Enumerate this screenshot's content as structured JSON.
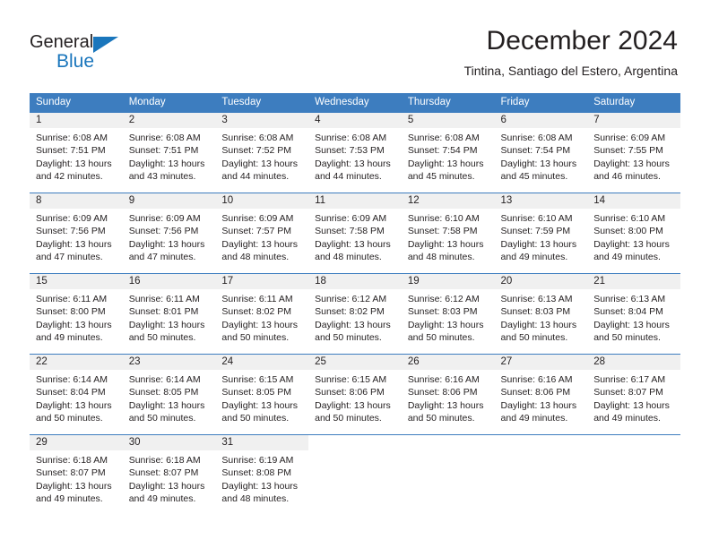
{
  "brand": {
    "name_part1": "General",
    "name_part2": "Blue",
    "accent_color": "#1a76bc"
  },
  "header": {
    "title": "December 2024",
    "location": "Tintina, Santiago del Estero, Argentina"
  },
  "calendar": {
    "header_color": "#3d7dbf",
    "weekdays": [
      "Sunday",
      "Monday",
      "Tuesday",
      "Wednesday",
      "Thursday",
      "Friday",
      "Saturday"
    ],
    "weeks": [
      [
        {
          "day": "1",
          "sunrise": "Sunrise: 6:08 AM",
          "sunset": "Sunset: 7:51 PM",
          "daylight_line1": "Daylight: 13 hours",
          "daylight_line2": "and 42 minutes."
        },
        {
          "day": "2",
          "sunrise": "Sunrise: 6:08 AM",
          "sunset": "Sunset: 7:51 PM",
          "daylight_line1": "Daylight: 13 hours",
          "daylight_line2": "and 43 minutes."
        },
        {
          "day": "3",
          "sunrise": "Sunrise: 6:08 AM",
          "sunset": "Sunset: 7:52 PM",
          "daylight_line1": "Daylight: 13 hours",
          "daylight_line2": "and 44 minutes."
        },
        {
          "day": "4",
          "sunrise": "Sunrise: 6:08 AM",
          "sunset": "Sunset: 7:53 PM",
          "daylight_line1": "Daylight: 13 hours",
          "daylight_line2": "and 44 minutes."
        },
        {
          "day": "5",
          "sunrise": "Sunrise: 6:08 AM",
          "sunset": "Sunset: 7:54 PM",
          "daylight_line1": "Daylight: 13 hours",
          "daylight_line2": "and 45 minutes."
        },
        {
          "day": "6",
          "sunrise": "Sunrise: 6:08 AM",
          "sunset": "Sunset: 7:54 PM",
          "daylight_line1": "Daylight: 13 hours",
          "daylight_line2": "and 45 minutes."
        },
        {
          "day": "7",
          "sunrise": "Sunrise: 6:09 AM",
          "sunset": "Sunset: 7:55 PM",
          "daylight_line1": "Daylight: 13 hours",
          "daylight_line2": "and 46 minutes."
        }
      ],
      [
        {
          "day": "8",
          "sunrise": "Sunrise: 6:09 AM",
          "sunset": "Sunset: 7:56 PM",
          "daylight_line1": "Daylight: 13 hours",
          "daylight_line2": "and 47 minutes."
        },
        {
          "day": "9",
          "sunrise": "Sunrise: 6:09 AM",
          "sunset": "Sunset: 7:56 PM",
          "daylight_line1": "Daylight: 13 hours",
          "daylight_line2": "and 47 minutes."
        },
        {
          "day": "10",
          "sunrise": "Sunrise: 6:09 AM",
          "sunset": "Sunset: 7:57 PM",
          "daylight_line1": "Daylight: 13 hours",
          "daylight_line2": "and 48 minutes."
        },
        {
          "day": "11",
          "sunrise": "Sunrise: 6:09 AM",
          "sunset": "Sunset: 7:58 PM",
          "daylight_line1": "Daylight: 13 hours",
          "daylight_line2": "and 48 minutes."
        },
        {
          "day": "12",
          "sunrise": "Sunrise: 6:10 AM",
          "sunset": "Sunset: 7:58 PM",
          "daylight_line1": "Daylight: 13 hours",
          "daylight_line2": "and 48 minutes."
        },
        {
          "day": "13",
          "sunrise": "Sunrise: 6:10 AM",
          "sunset": "Sunset: 7:59 PM",
          "daylight_line1": "Daylight: 13 hours",
          "daylight_line2": "and 49 minutes."
        },
        {
          "day": "14",
          "sunrise": "Sunrise: 6:10 AM",
          "sunset": "Sunset: 8:00 PM",
          "daylight_line1": "Daylight: 13 hours",
          "daylight_line2": "and 49 minutes."
        }
      ],
      [
        {
          "day": "15",
          "sunrise": "Sunrise: 6:11 AM",
          "sunset": "Sunset: 8:00 PM",
          "daylight_line1": "Daylight: 13 hours",
          "daylight_line2": "and 49 minutes."
        },
        {
          "day": "16",
          "sunrise": "Sunrise: 6:11 AM",
          "sunset": "Sunset: 8:01 PM",
          "daylight_line1": "Daylight: 13 hours",
          "daylight_line2": "and 50 minutes."
        },
        {
          "day": "17",
          "sunrise": "Sunrise: 6:11 AM",
          "sunset": "Sunset: 8:02 PM",
          "daylight_line1": "Daylight: 13 hours",
          "daylight_line2": "and 50 minutes."
        },
        {
          "day": "18",
          "sunrise": "Sunrise: 6:12 AM",
          "sunset": "Sunset: 8:02 PM",
          "daylight_line1": "Daylight: 13 hours",
          "daylight_line2": "and 50 minutes."
        },
        {
          "day": "19",
          "sunrise": "Sunrise: 6:12 AM",
          "sunset": "Sunset: 8:03 PM",
          "daylight_line1": "Daylight: 13 hours",
          "daylight_line2": "and 50 minutes."
        },
        {
          "day": "20",
          "sunrise": "Sunrise: 6:13 AM",
          "sunset": "Sunset: 8:03 PM",
          "daylight_line1": "Daylight: 13 hours",
          "daylight_line2": "and 50 minutes."
        },
        {
          "day": "21",
          "sunrise": "Sunrise: 6:13 AM",
          "sunset": "Sunset: 8:04 PM",
          "daylight_line1": "Daylight: 13 hours",
          "daylight_line2": "and 50 minutes."
        }
      ],
      [
        {
          "day": "22",
          "sunrise": "Sunrise: 6:14 AM",
          "sunset": "Sunset: 8:04 PM",
          "daylight_line1": "Daylight: 13 hours",
          "daylight_line2": "and 50 minutes."
        },
        {
          "day": "23",
          "sunrise": "Sunrise: 6:14 AM",
          "sunset": "Sunset: 8:05 PM",
          "daylight_line1": "Daylight: 13 hours",
          "daylight_line2": "and 50 minutes."
        },
        {
          "day": "24",
          "sunrise": "Sunrise: 6:15 AM",
          "sunset": "Sunset: 8:05 PM",
          "daylight_line1": "Daylight: 13 hours",
          "daylight_line2": "and 50 minutes."
        },
        {
          "day": "25",
          "sunrise": "Sunrise: 6:15 AM",
          "sunset": "Sunset: 8:06 PM",
          "daylight_line1": "Daylight: 13 hours",
          "daylight_line2": "and 50 minutes."
        },
        {
          "day": "26",
          "sunrise": "Sunrise: 6:16 AM",
          "sunset": "Sunset: 8:06 PM",
          "daylight_line1": "Daylight: 13 hours",
          "daylight_line2": "and 50 minutes."
        },
        {
          "day": "27",
          "sunrise": "Sunrise: 6:16 AM",
          "sunset": "Sunset: 8:06 PM",
          "daylight_line1": "Daylight: 13 hours",
          "daylight_line2": "and 49 minutes."
        },
        {
          "day": "28",
          "sunrise": "Sunrise: 6:17 AM",
          "sunset": "Sunset: 8:07 PM",
          "daylight_line1": "Daylight: 13 hours",
          "daylight_line2": "and 49 minutes."
        }
      ],
      [
        {
          "day": "29",
          "sunrise": "Sunrise: 6:18 AM",
          "sunset": "Sunset: 8:07 PM",
          "daylight_line1": "Daylight: 13 hours",
          "daylight_line2": "and 49 minutes."
        },
        {
          "day": "30",
          "sunrise": "Sunrise: 6:18 AM",
          "sunset": "Sunset: 8:07 PM",
          "daylight_line1": "Daylight: 13 hours",
          "daylight_line2": "and 49 minutes."
        },
        {
          "day": "31",
          "sunrise": "Sunrise: 6:19 AM",
          "sunset": "Sunset: 8:08 PM",
          "daylight_line1": "Daylight: 13 hours",
          "daylight_line2": "and 48 minutes."
        },
        {
          "day": "",
          "sunrise": "",
          "sunset": "",
          "daylight_line1": "",
          "daylight_line2": ""
        },
        {
          "day": "",
          "sunrise": "",
          "sunset": "",
          "daylight_line1": "",
          "daylight_line2": ""
        },
        {
          "day": "",
          "sunrise": "",
          "sunset": "",
          "daylight_line1": "",
          "daylight_line2": ""
        },
        {
          "day": "",
          "sunrise": "",
          "sunset": "",
          "daylight_line1": "",
          "daylight_line2": ""
        }
      ]
    ]
  }
}
